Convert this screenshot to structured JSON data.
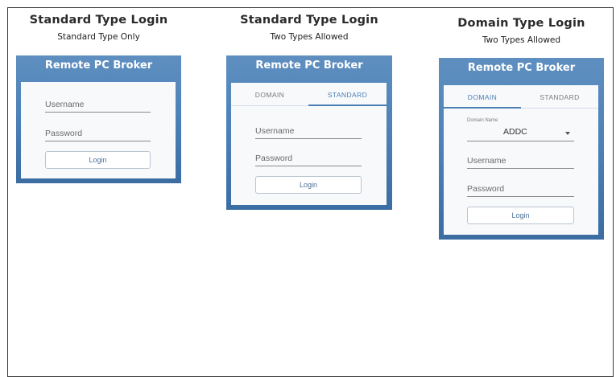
{
  "columns": [
    {
      "title": "Standard Type Login",
      "subtitle": "Standard Type Only",
      "card": {
        "title": "Remote PC Broker",
        "username_placeholder": "Username",
        "password_placeholder": "Password",
        "login_label": "Login"
      }
    },
    {
      "title": "Standard Type Login",
      "subtitle": "Two Types Allowed",
      "card": {
        "title": "Remote PC Broker",
        "tabs": [
          {
            "label": "DOMAIN",
            "active": false
          },
          {
            "label": "STANDARD",
            "active": true
          }
        ],
        "username_placeholder": "Username",
        "password_placeholder": "Password",
        "login_label": "Login"
      }
    },
    {
      "title": "Domain Type Login",
      "subtitle": "Two Types Allowed",
      "card": {
        "title": "Remote PC Broker",
        "tabs": [
          {
            "label": "DOMAIN",
            "active": true
          },
          {
            "label": "STANDARD",
            "active": false
          }
        ],
        "domain_label": "Domain Name",
        "domain_value": "ADDC",
        "username_placeholder": "Username",
        "password_placeholder": "Password",
        "login_label": "Login"
      }
    }
  ],
  "colors": {
    "card_gradient_top": "#5f8fc0",
    "card_gradient_bottom": "#3b6da3",
    "accent": "#4a7fb5"
  },
  "icons": {
    "dropdown": "chevron-down-icon"
  }
}
